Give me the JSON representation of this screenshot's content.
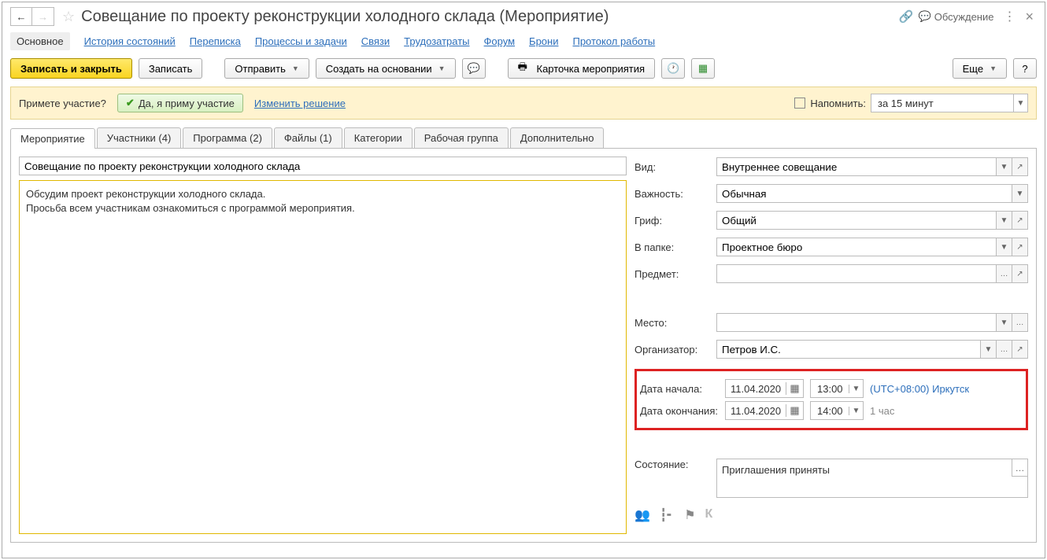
{
  "header": {
    "title": "Совещание по проекту реконструкции холодного склада (Мероприятие)",
    "discuss": "Обсуждение"
  },
  "nav": {
    "main": "Основное",
    "history": "История состояний",
    "correspondence": "Переписка",
    "processes": "Процессы и задачи",
    "links": "Связи",
    "labor": "Трудозатраты",
    "forum": "Форум",
    "booking": "Брони",
    "protocol": "Протокол работы"
  },
  "toolbar": {
    "save_close": "Записать и закрыть",
    "save": "Записать",
    "send": "Отправить",
    "create_based": "Создать на основании",
    "event_card": "Карточка мероприятия",
    "more": "Еще",
    "help": "?"
  },
  "participation": {
    "question": "Примете участие?",
    "accept": "Да, я приму участие",
    "change": "Изменить решение",
    "remind_label": "Напомнить:",
    "remind_value": "за 15 минут"
  },
  "tabs": {
    "event": "Мероприятие",
    "participants": "Участники (4)",
    "program": "Программа (2)",
    "files": "Файлы (1)",
    "categories": "Категории",
    "workgroup": "Рабочая группа",
    "additional": "Дополнительно"
  },
  "form": {
    "subject": "Совещание по проекту реконструкции холодного склада",
    "description_l1": "Обсудим проект реконструкции холодного склада.",
    "description_l2": "Просьба всем участникам ознакомиться с программой мероприятия.",
    "labels": {
      "kind": "Вид:",
      "importance": "Важность:",
      "grif": "Гриф:",
      "folder": "В папке:",
      "subject_field": "Предмет:",
      "place": "Место:",
      "organizer": "Организатор:",
      "start": "Дата начала:",
      "end": "Дата окончания:",
      "state": "Состояние:"
    },
    "values": {
      "kind": "Внутреннее совещание",
      "importance": "Обычная",
      "grif": "Общий",
      "folder": "Проектное бюро",
      "subject_field": "",
      "place": "",
      "organizer": "Петров И.С.",
      "start_date": "11.04.2020",
      "start_time": "13:00",
      "end_date": "11.04.2020",
      "end_time": "14:00",
      "timezone": "(UTC+08:00) Иркутск",
      "duration": "1 час",
      "state": "Приглашения приняты"
    }
  }
}
